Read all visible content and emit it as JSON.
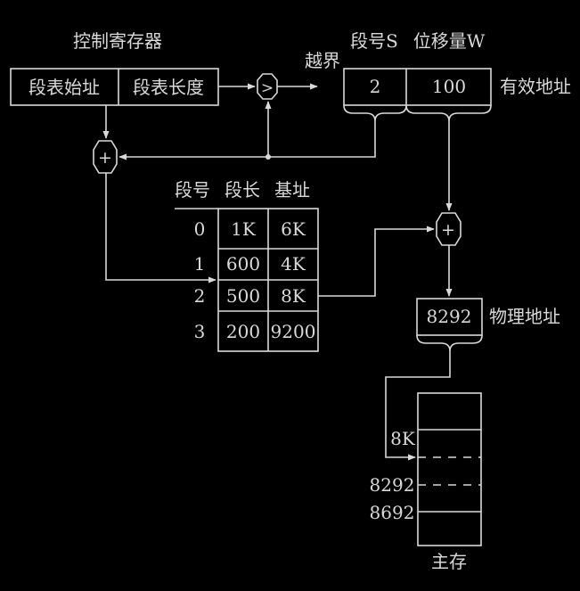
{
  "colors": {
    "background": "#000000",
    "foreground": "#d9d9d9"
  },
  "control_register": {
    "title": "控制寄存器",
    "field_start": "段表始址",
    "field_length": "段表长度"
  },
  "compare_symbol": ">",
  "overflow_label": "越界",
  "logical_address": {
    "segment_header": "段号S",
    "offset_header": "位移量W",
    "segment_value": "2",
    "offset_value": "100",
    "caption": "有效地址"
  },
  "adder_symbol": "+",
  "segment_table": {
    "headers": [
      "段号",
      "段长",
      "基址"
    ],
    "rows": [
      [
        "0",
        "1K",
        "6K"
      ],
      [
        "1",
        "600",
        "4K"
      ],
      [
        "2",
        "500",
        "8K"
      ],
      [
        "3",
        "200",
        "9200"
      ]
    ]
  },
  "physical_address": {
    "value": "8292",
    "caption": "物理地址"
  },
  "main_memory": {
    "caption": "主存",
    "marks": [
      "8K",
      "8292",
      "8692"
    ]
  }
}
